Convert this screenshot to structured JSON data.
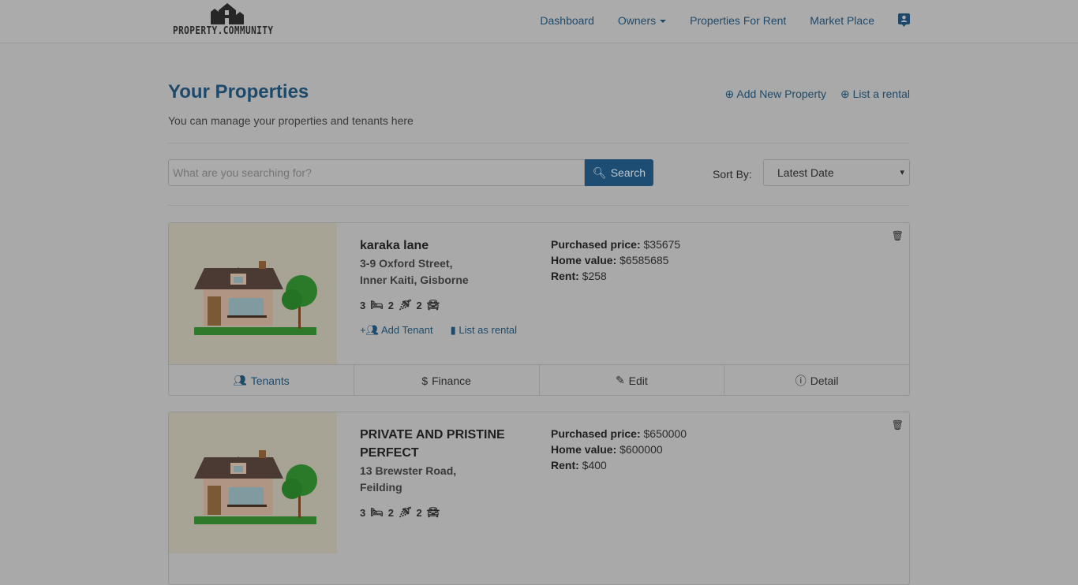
{
  "brand": {
    "name": "PROPERTY.COMMUNITY"
  },
  "nav": {
    "items": [
      "Dashboard",
      "Owners",
      "Properties For Rent",
      "Market Place"
    ],
    "profile_icon": "user-badge-icon"
  },
  "header": {
    "title": "Your Properties",
    "subtitle": "You can manage your properties and tenants here",
    "add_property": "Add New Property",
    "list_rental": "List a rental"
  },
  "search": {
    "placeholder": "What are you searching for?",
    "button": "Search",
    "sort_label": "Sort By:",
    "sort_value": "Latest Date"
  },
  "properties": [
    {
      "name": "karaka lane",
      "address1": "3-9 Oxford Street,",
      "address2": "Inner Kaiti, Gisborne",
      "beds": "3",
      "baths": "2",
      "cars": "2",
      "purchased_label": "Purchased price:",
      "purchased": "$35675",
      "home_label": "Home value:",
      "home": "$6585685",
      "rent_label": "Rent:",
      "rent": "$258",
      "add_tenant": "Add Tenant",
      "list_rental": "List as rental"
    },
    {
      "name": "PRIVATE AND PRISTINE PERFECT",
      "address1": "13 Brewster Road,",
      "address2": "Feilding",
      "beds": "3",
      "baths": "2",
      "cars": "2",
      "purchased_label": "Purchased price:",
      "purchased": "$650000",
      "home_label": "Home value:",
      "home": "$600000",
      "rent_label": "Rent:",
      "rent": "$400"
    }
  ],
  "card_footer": {
    "tenants": "Tenants",
    "finance": "Finance",
    "edit": "Edit",
    "detail": "Detail"
  },
  "colors": {
    "accent": "#1e4a6a",
    "overlay": "#a9a9a9"
  }
}
